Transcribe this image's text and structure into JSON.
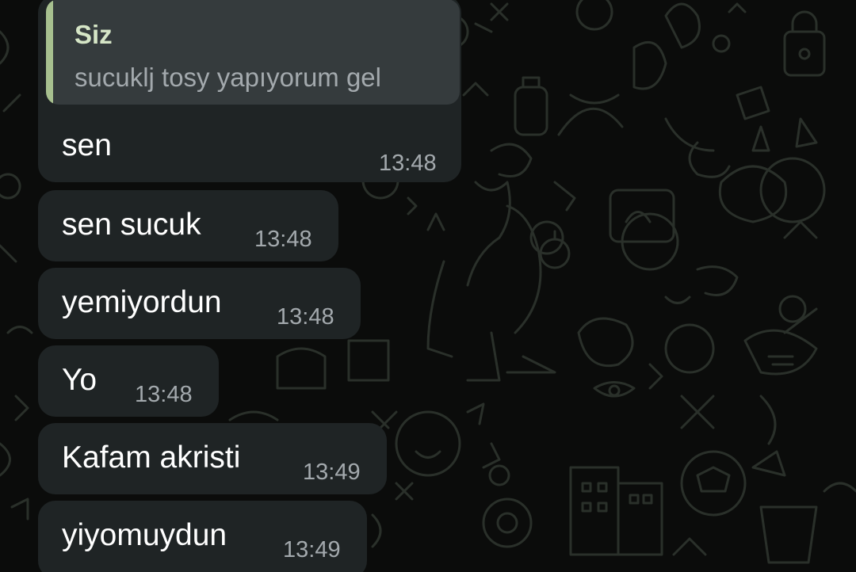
{
  "colors": {
    "background": "#0b0c0b",
    "bubble": "#1f2425",
    "quote_bg": "#353b3d",
    "quote_accent": "#a7c08f",
    "text": "#ffffff",
    "timestamp": "#a3a9ad"
  },
  "quoted_reply": {
    "author": "Siz",
    "text": "sucuklj tosy yapıyorum gel"
  },
  "messages": [
    {
      "text": "sen",
      "time": "13:48"
    },
    {
      "text": "sen sucuk",
      "time": "13:48"
    },
    {
      "text": "yemiyordun",
      "time": "13:48"
    },
    {
      "text": "Yo",
      "time": "13:48"
    },
    {
      "text": "Kafam akristi",
      "time": "13:49"
    },
    {
      "text": "yiyomuydun",
      "time": "13:49"
    }
  ]
}
